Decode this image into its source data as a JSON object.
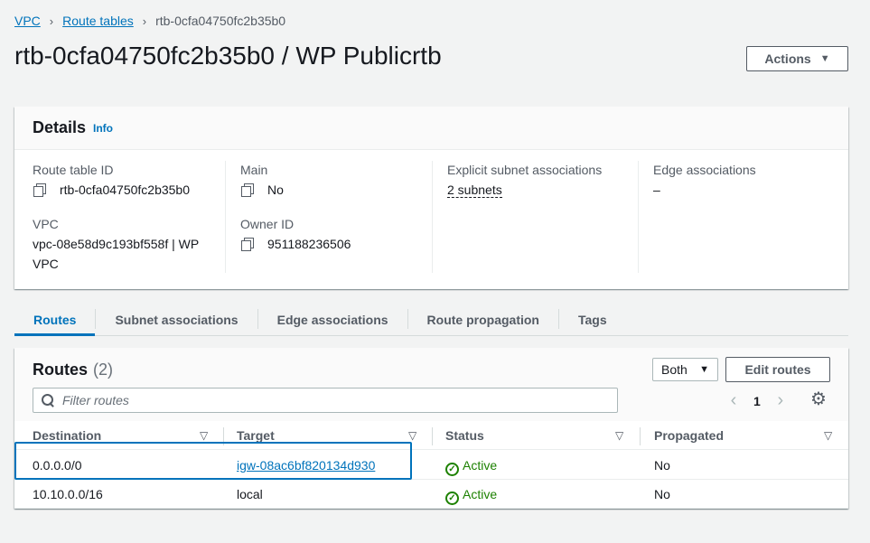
{
  "breadcrumb": {
    "items": [
      "VPC",
      "Route tables"
    ],
    "current": "rtb-0cfa04750fc2b35b0",
    "separator": "›"
  },
  "page": {
    "title": "rtb-0cfa04750fc2b35b0 / WP Publicrtb",
    "actions_label": "Actions"
  },
  "details": {
    "title": "Details",
    "info_label": "Info",
    "route_table_id_label": "Route table ID",
    "route_table_id": "rtb-0cfa04750fc2b35b0",
    "vpc_label": "VPC",
    "vpc_value_line1": "vpc-08e58d9c193bf558f | WP",
    "vpc_value_line2": "VPC",
    "main_label": "Main",
    "main_value": "No",
    "owner_id_label": "Owner ID",
    "owner_id": "951188236506",
    "explicit_subnet_label": "Explicit subnet associations",
    "explicit_subnet_value": "2 subnets",
    "edge_assoc_label": "Edge associations",
    "edge_assoc_value": "–"
  },
  "tabs": [
    "Routes",
    "Subnet associations",
    "Edge associations",
    "Route propagation",
    "Tags"
  ],
  "routes": {
    "title": "Routes",
    "count": "(2)",
    "filter_select": "Both",
    "edit_label": "Edit routes",
    "filter_placeholder": "Filter routes",
    "page_number": "1",
    "columns": [
      "Destination",
      "Target",
      "Status",
      "Propagated"
    ],
    "rows": [
      {
        "destination": "0.0.0.0/0",
        "target": "igw-08ac6bf820134d930",
        "status": "Active",
        "propagated": "No"
      },
      {
        "destination": "10.10.0.0/16",
        "target": "local",
        "status": "Active",
        "propagated": "No"
      }
    ]
  },
  "colors": {
    "link": "#0073bb",
    "success": "#1d8102",
    "background": "#f2f3f3"
  }
}
